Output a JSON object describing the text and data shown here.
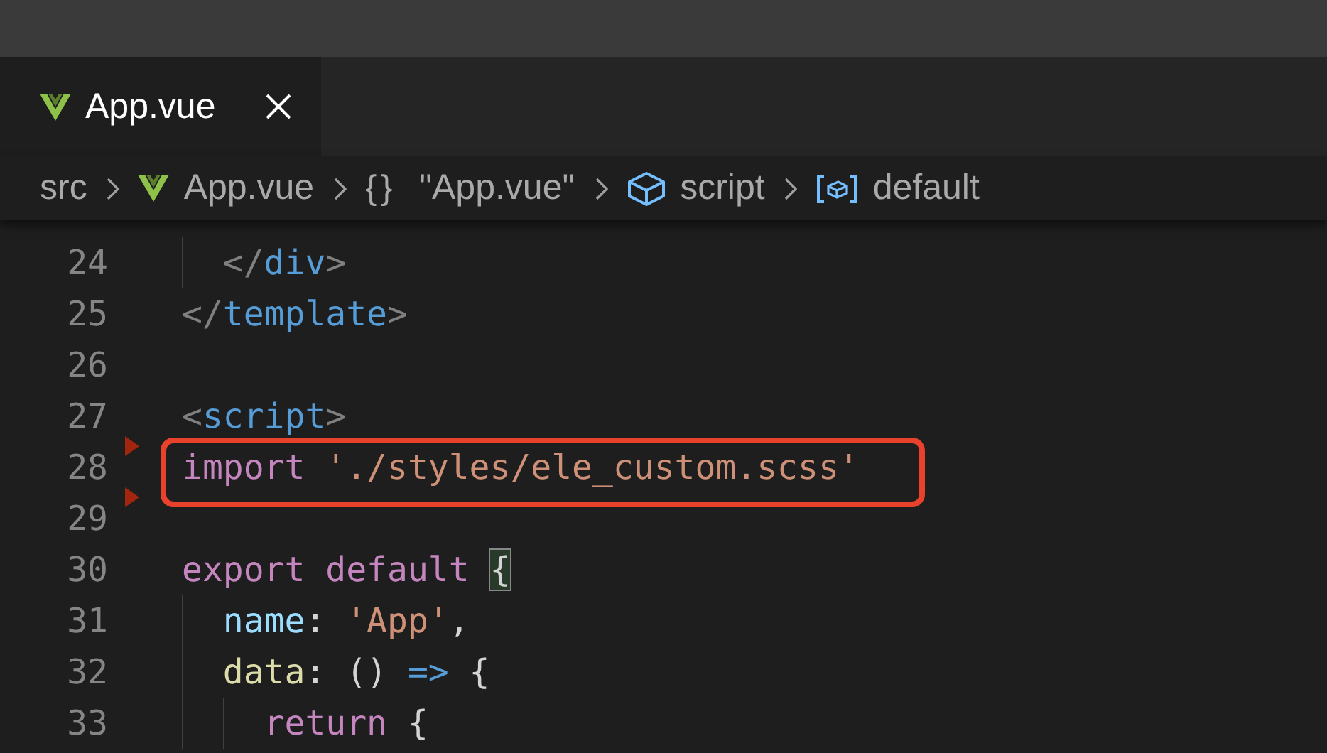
{
  "tabs": [
    {
      "label": "App.vue",
      "kind": "vue",
      "selected": true
    }
  ],
  "breadcrumbs": [
    {
      "label": "src",
      "kind": "folder"
    },
    {
      "label": "App.vue",
      "kind": "vue"
    },
    {
      "label": "\"App.vue\"",
      "kind": "object",
      "glyph": "{}"
    },
    {
      "label": "script",
      "kind": "module"
    },
    {
      "label": "default",
      "kind": "variable"
    }
  ],
  "editor": {
    "lines": [
      {
        "number": "24",
        "tokens": [
          {
            "text": "  </",
            "kind": "punct"
          },
          {
            "text": "div",
            "kind": "tag"
          },
          {
            "text": ">",
            "kind": "punct"
          }
        ]
      },
      {
        "number": "25",
        "tokens": [
          {
            "text": "</",
            "kind": "punct"
          },
          {
            "text": "template",
            "kind": "tag"
          },
          {
            "text": ">",
            "kind": "punct"
          }
        ]
      },
      {
        "number": "26"
      },
      {
        "number": "27",
        "tokens": [
          {
            "text": "<",
            "kind": "punct"
          },
          {
            "text": "script",
            "kind": "tag"
          },
          {
            "text": ">",
            "kind": "punct"
          }
        ]
      },
      {
        "number": "28",
        "marker": true,
        "annotated": true,
        "tokens": [
          {
            "text": "import ",
            "kind": "keyword"
          },
          {
            "text": "'./styles/ele_custom.scss'",
            "kind": "string"
          }
        ]
      },
      {
        "number": "29",
        "marker": true
      },
      {
        "number": "30",
        "tokens": [
          {
            "text": "export default ",
            "kind": "keyword"
          },
          {
            "text": "{",
            "kind": "bracket-match"
          }
        ]
      },
      {
        "number": "31",
        "tokens": [
          {
            "text": "  name",
            "kind": "prop"
          },
          {
            "text": ": ",
            "kind": "plain"
          },
          {
            "text": "'App'",
            "kind": "string"
          },
          {
            "text": ",",
            "kind": "plain"
          }
        ]
      },
      {
        "number": "32",
        "tokens": [
          {
            "text": "  data",
            "kind": "func"
          },
          {
            "text": ": () ",
            "kind": "plain"
          },
          {
            "text": "=>",
            "kind": "operator"
          },
          {
            "text": " {",
            "kind": "plain"
          }
        ]
      },
      {
        "number": "33",
        "tokens": [
          {
            "text": "    return",
            "kind": "keyword"
          },
          {
            "text": " {",
            "kind": "plain"
          }
        ]
      }
    ]
  }
}
